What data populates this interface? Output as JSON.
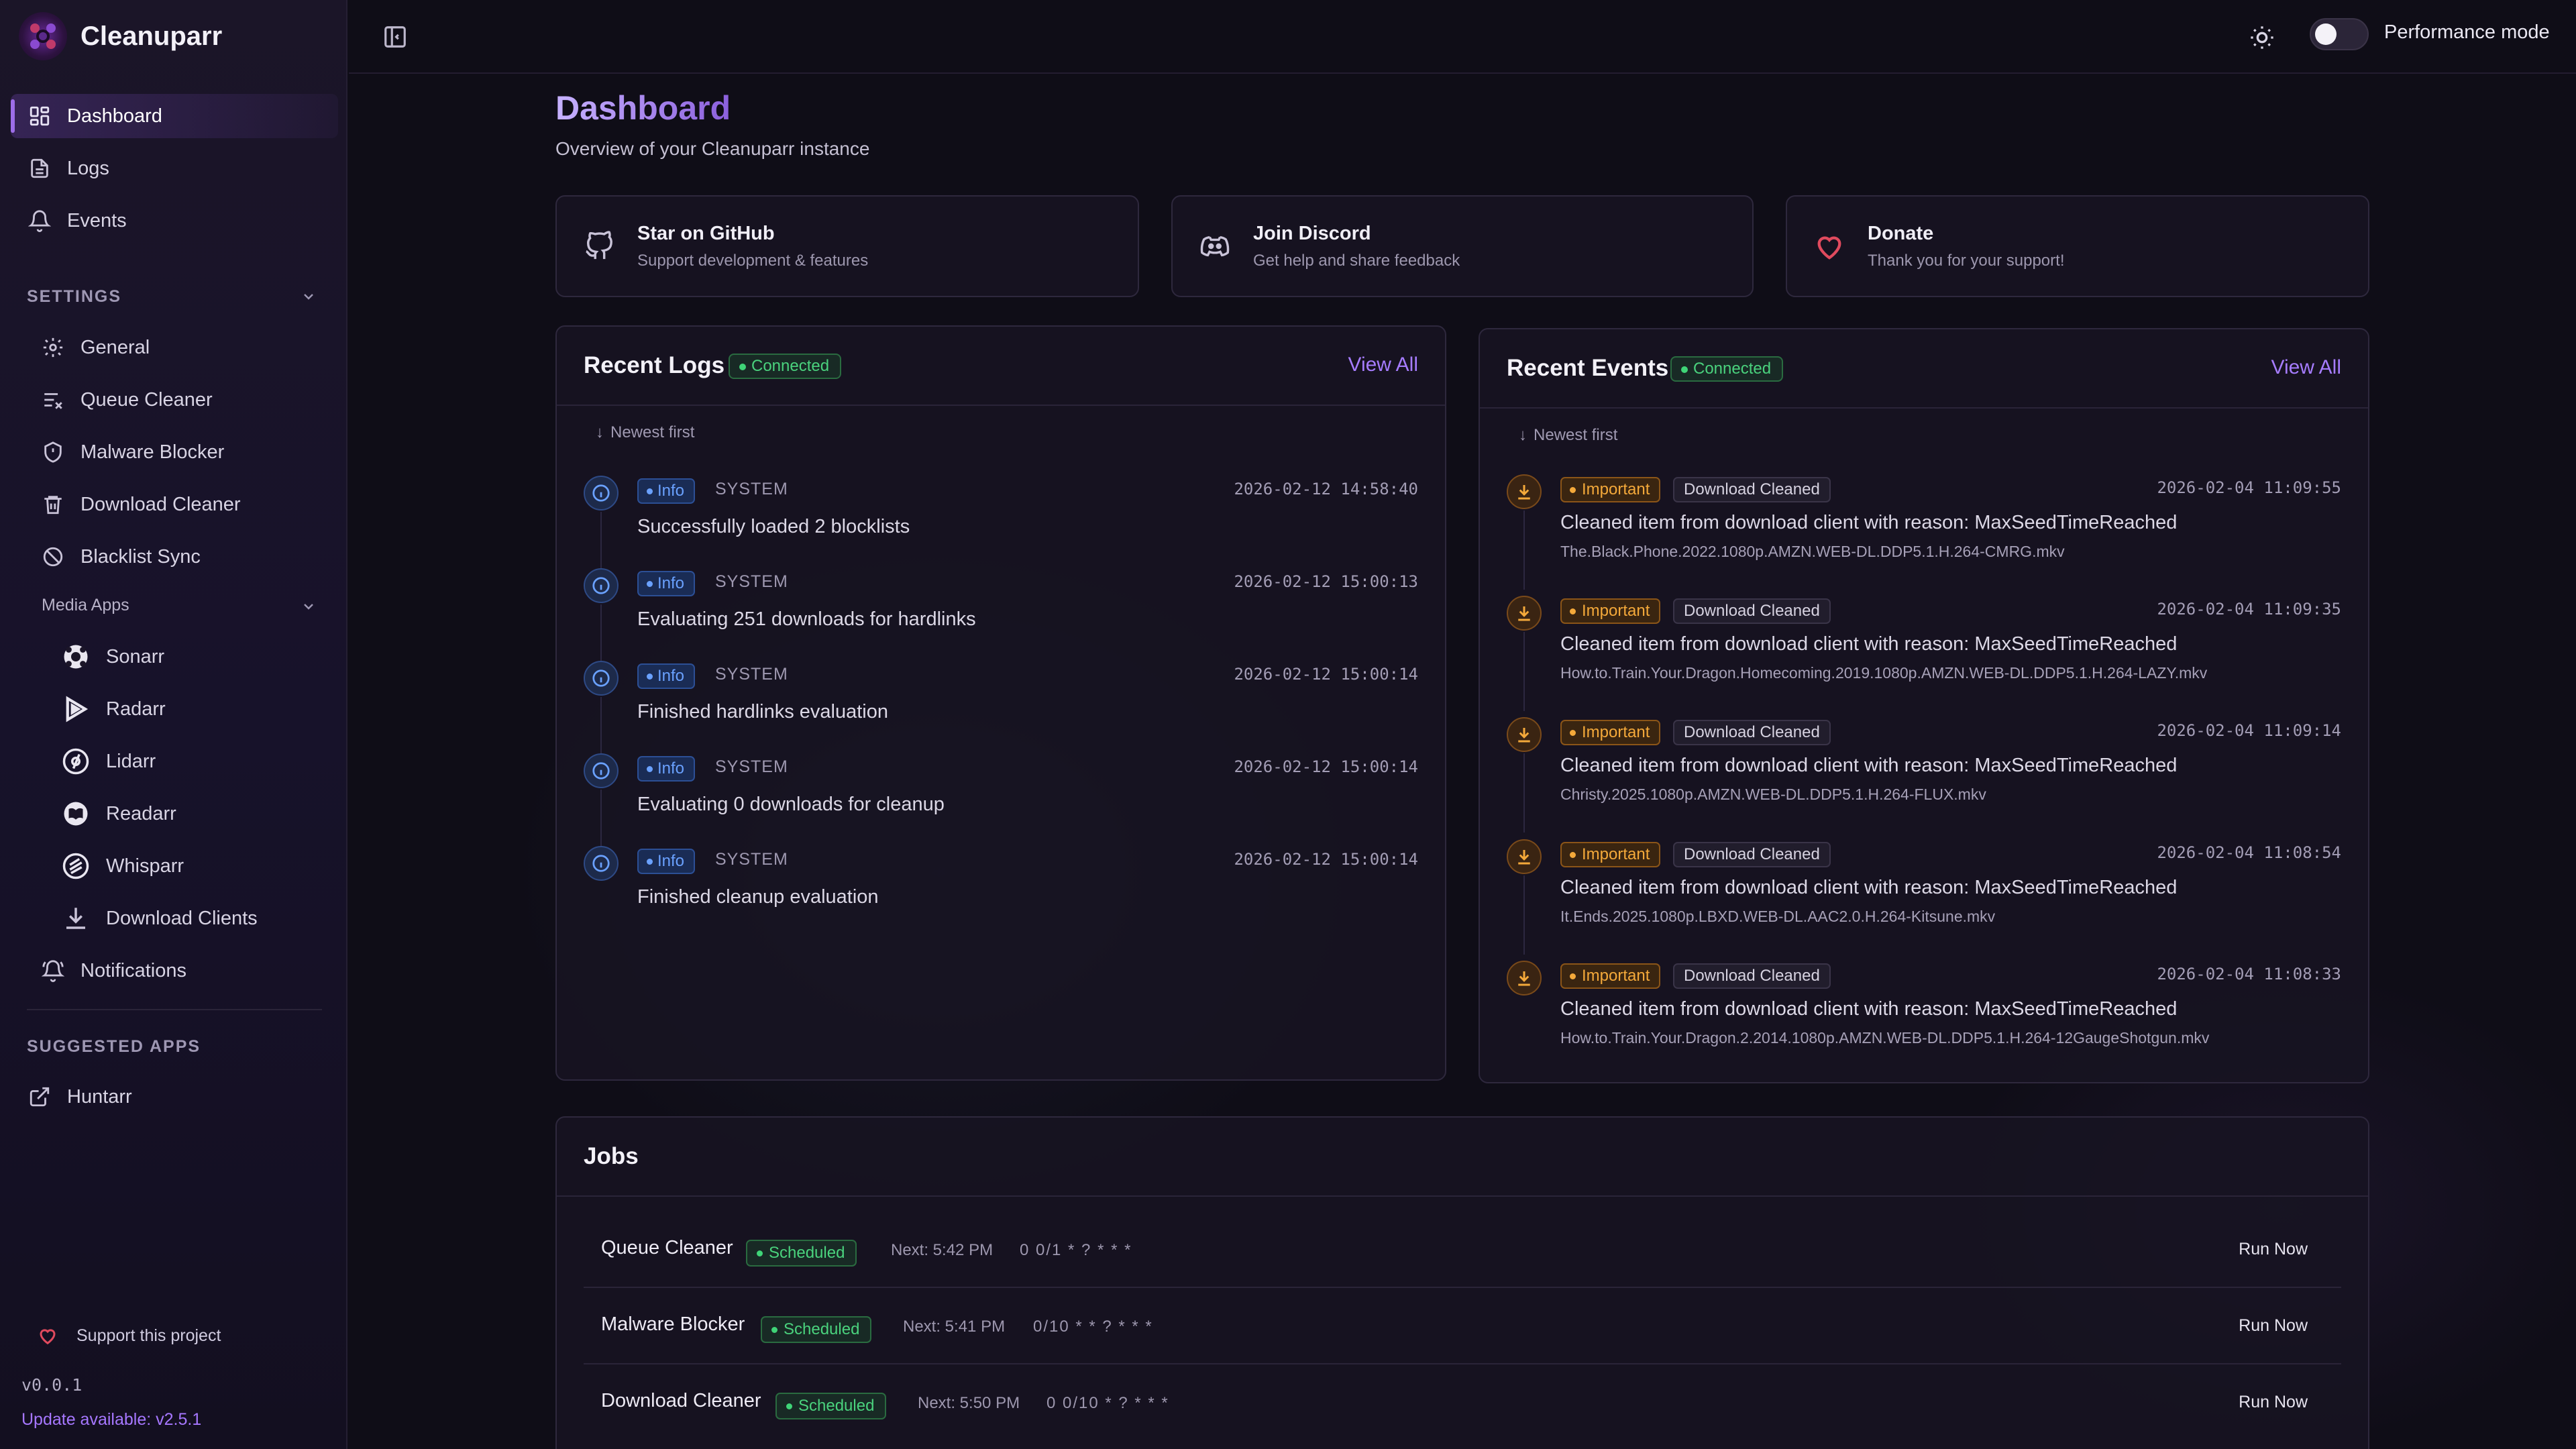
{
  "app": {
    "name": "Cleanuparr"
  },
  "nav": {
    "dashboard": "Dashboard",
    "logs": "Logs",
    "events": "Events",
    "settings_label": "SETTINGS",
    "general": "General",
    "queue_cleaner": "Queue Cleaner",
    "malware_blocker": "Malware Blocker",
    "download_cleaner": "Download Cleaner",
    "blacklist_sync": "Blacklist Sync",
    "media_apps_label": "Media Apps",
    "sonarr": "Sonarr",
    "radarr": "Radarr",
    "lidarr": "Lidarr",
    "readarr": "Readarr",
    "whisparr": "Whisparr",
    "download_clients": "Download Clients",
    "notifications": "Notifications",
    "suggested_label": "SUGGESTED APPS",
    "huntarr": "Huntarr"
  },
  "footer": {
    "support": "Support this project",
    "version": "v0.0.1",
    "update": "Update available: v2.5.1"
  },
  "topbar": {
    "performance_mode": "Performance mode"
  },
  "page": {
    "title": "Dashboard",
    "subtitle": "Overview of your Cleanuparr instance"
  },
  "links": [
    {
      "title": "Star on GitHub",
      "sub": "Support development & features"
    },
    {
      "title": "Join Discord",
      "sub": "Get help and share feedback"
    },
    {
      "title": "Donate",
      "sub": "Thank you for your support!"
    }
  ],
  "logs": {
    "title": "Recent Logs",
    "status": "Connected",
    "view_all": "View All",
    "sort": "Newest first",
    "items": [
      {
        "level": "Info",
        "source": "SYSTEM",
        "time": "2026-02-12 14:58:40",
        "message": "Successfully loaded 2 blocklists"
      },
      {
        "level": "Info",
        "source": "SYSTEM",
        "time": "2026-02-12 15:00:13",
        "message": "Evaluating 251 downloads for hardlinks"
      },
      {
        "level": "Info",
        "source": "SYSTEM",
        "time": "2026-02-12 15:00:14",
        "message": "Finished hardlinks evaluation"
      },
      {
        "level": "Info",
        "source": "SYSTEM",
        "time": "2026-02-12 15:00:14",
        "message": "Evaluating 0 downloads for cleanup"
      },
      {
        "level": "Info",
        "source": "SYSTEM",
        "time": "2026-02-12 15:00:14",
        "message": "Finished cleanup evaluation"
      }
    ]
  },
  "events": {
    "title": "Recent Events",
    "status": "Connected",
    "view_all": "View All",
    "sort": "Newest first",
    "items": [
      {
        "severity": "Important",
        "type": "Download Cleaned",
        "time": "2026-02-04 11:09:55",
        "message": "Cleaned item from download client with reason: MaxSeedTimeReached",
        "file": "The.Black.Phone.2022.1080p.AMZN.WEB-DL.DDP5.1.H.264-CMRG.mkv"
      },
      {
        "severity": "Important",
        "type": "Download Cleaned",
        "time": "2026-02-04 11:09:35",
        "message": "Cleaned item from download client with reason: MaxSeedTimeReached",
        "file": "How.to.Train.Your.Dragon.Homecoming.2019.1080p.AMZN.WEB-DL.DDP5.1.H.264-LAZY.mkv"
      },
      {
        "severity": "Important",
        "type": "Download Cleaned",
        "time": "2026-02-04 11:09:14",
        "message": "Cleaned item from download client with reason: MaxSeedTimeReached",
        "file": "Christy.2025.1080p.AMZN.WEB-DL.DDP5.1.H.264-FLUX.mkv"
      },
      {
        "severity": "Important",
        "type": "Download Cleaned",
        "time": "2026-02-04 11:08:54",
        "message": "Cleaned item from download client with reason: MaxSeedTimeReached",
        "file": "It.Ends.2025.1080p.LBXD.WEB-DL.AAC2.0.H.264-Kitsune.mkv"
      },
      {
        "severity": "Important",
        "type": "Download Cleaned",
        "time": "2026-02-04 11:08:33",
        "message": "Cleaned item from download client with reason: MaxSeedTimeReached",
        "file": "How.to.Train.Your.Dragon.2.2014.1080p.AMZN.WEB-DL.DDP5.1.H.264-12GaugeShotgun.mkv"
      }
    ]
  },
  "jobs": {
    "title": "Jobs",
    "items": [
      {
        "name": "Queue Cleaner",
        "status": "Scheduled",
        "next": "Next: 5:42 PM",
        "cron": "0 0/1 * ? * * *",
        "action": "Run Now"
      },
      {
        "name": "Malware Blocker",
        "status": "Scheduled",
        "next": "Next: 5:41 PM",
        "cron": "0/10 * * ? * * *",
        "action": "Run Now"
      },
      {
        "name": "Download Cleaner",
        "status": "Scheduled",
        "next": "Next: 5:50 PM",
        "cron": "0 0/10 * ? * * *",
        "action": "Run Now"
      }
    ]
  }
}
